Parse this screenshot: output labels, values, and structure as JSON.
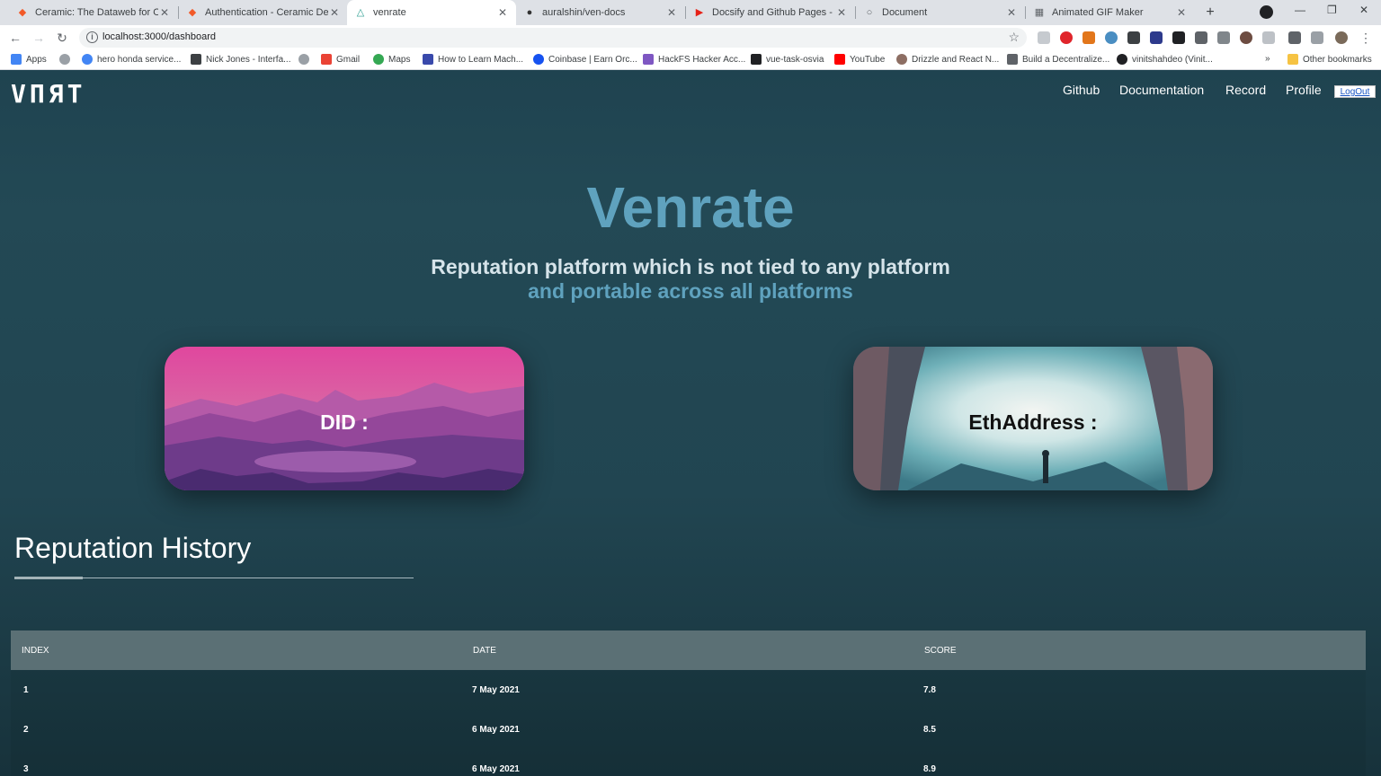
{
  "browser": {
    "tabs": [
      {
        "title": "Ceramic: The Dataweb for Open",
        "icon": "ceramic-icon"
      },
      {
        "title": "Authentication - Ceramic Develc",
        "icon": "ceramic-icon"
      },
      {
        "title": "venrate",
        "icon": "venrate-icon"
      },
      {
        "title": "auralshin/ven-docs",
        "icon": "github-icon"
      },
      {
        "title": "Docsify and Github Pages - You",
        "icon": "youtube-icon"
      },
      {
        "title": "Document",
        "icon": "globe-icon"
      },
      {
        "title": "Animated GIF Maker",
        "icon": "gif-icon"
      }
    ],
    "url": "localhost:3000/dashboard",
    "bookmarks": [
      "Apps",
      "hero honda service...",
      "Nick Jones - Interfa...",
      "Gmail",
      "Maps",
      "How to Learn Mach...",
      "Coinbase | Earn Orc...",
      "HackFS Hacker Acc...",
      "vue-task-osvia",
      "YouTube",
      "Drizzle and React N...",
      "Build a Decentralize...",
      "vinitshahdeo (Vinit...",
      "Other bookmarks"
    ]
  },
  "site": {
    "logo": "VПЯТ",
    "nav": [
      "Github",
      "Documentation",
      "Record",
      "Profile"
    ],
    "logout": "LogOut"
  },
  "hero": {
    "title": "Venrate",
    "subtitle_line1": "Reputation platform which is not tied to any platform",
    "subtitle_line2": "and portable across all platforms"
  },
  "cards": {
    "did_label": "DID :",
    "eth_label": "EthAddress :"
  },
  "history": {
    "title": "Reputation History",
    "columns": [
      "INDEX",
      "DATE",
      "SCORE"
    ],
    "rows": [
      {
        "index": "1",
        "date": "7 May 2021",
        "score": "7.8"
      },
      {
        "index": "2",
        "date": "6 May 2021",
        "score": "8.5"
      },
      {
        "index": "3",
        "date": "6 May 2021",
        "score": "8.9"
      }
    ]
  },
  "colors": {
    "accent": "#5fa2be",
    "page_bg": "#214551",
    "table_header": "#5b7075"
  }
}
